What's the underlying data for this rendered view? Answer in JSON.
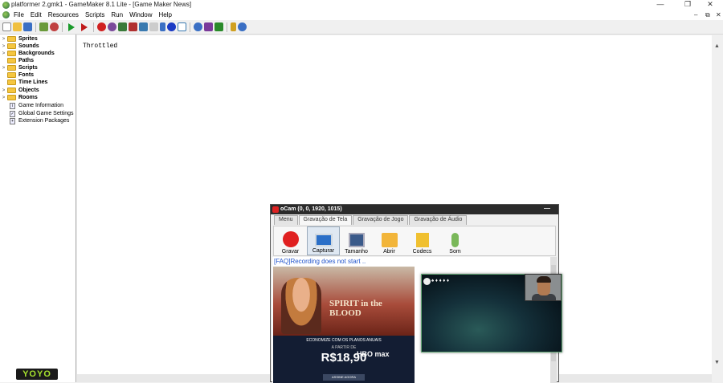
{
  "window": {
    "title": "platformer 2.gmk1 - GameMaker 8.1 Lite - [Game Maker News]",
    "controls": {
      "minimize": "—",
      "restore": "❐",
      "close": "✕"
    },
    "mdi_controls": {
      "minimize": "–",
      "restore": "⧉",
      "close": "✕"
    }
  },
  "menu": [
    "File",
    "Edit",
    "Resources",
    "Scripts",
    "Run",
    "Window",
    "Help"
  ],
  "toolbar_icons": [
    {
      "name": "new-icon",
      "color": "#ffffff"
    },
    {
      "name": "open-icon",
      "color": "#f0c040"
    },
    {
      "name": "save-icon",
      "color": "#3a6fc4"
    },
    {
      "name": "publish-icon",
      "color": "#6a9a3a"
    },
    {
      "name": "exe-icon",
      "color": "#c04040"
    },
    {
      "name": "run-icon",
      "color": "#1a9a2a"
    },
    {
      "name": "debug-icon",
      "color": "#c01a1a"
    },
    {
      "name": "sprite-icon",
      "color": "#d02020"
    },
    {
      "name": "sound-icon",
      "color": "#7a4a9a"
    },
    {
      "name": "background-icon",
      "color": "#3a7a3a"
    },
    {
      "name": "path-icon",
      "color": "#b03030"
    },
    {
      "name": "script-icon",
      "color": "#3a7ab0"
    },
    {
      "name": "font-icon",
      "color": "#444444"
    },
    {
      "name": "timeline-icon",
      "color": "#3a6fc4"
    },
    {
      "name": "object-icon",
      "color": "#1a3ac4"
    },
    {
      "name": "room-icon",
      "color": "#3a7ab0"
    },
    {
      "name": "game-info-icon",
      "color": "#3a6fc4"
    },
    {
      "name": "game-settings-icon",
      "color": "#7a3a9a"
    },
    {
      "name": "extension-icon",
      "color": "#2a8a2a"
    },
    {
      "name": "manual-icon",
      "color": "#d0a020"
    },
    {
      "name": "help-icon",
      "color": "#3a6fc4"
    }
  ],
  "tree": {
    "folders": [
      "Sprites",
      "Sounds",
      "Backgrounds",
      "Paths",
      "Scripts",
      "Fonts",
      "Time Lines",
      "Objects",
      "Rooms"
    ],
    "items": [
      "Game Information",
      "Global Game Settings",
      "Extension Packages"
    ]
  },
  "main": {
    "text": "Throttled"
  },
  "logo": {
    "text": "YOYO"
  },
  "ocam": {
    "title": "oCam (0, 0, 1920, 1015)",
    "min_label": "—",
    "tabs": [
      "Menu",
      "Gravação de Tela",
      "Gravação de Jogo",
      "Gravação de Áudio"
    ],
    "active_tab": "Gravação de Tela",
    "buttons": [
      {
        "label": "Gravar",
        "icon": "record-icon",
        "color": "#e02020"
      },
      {
        "label": "Capturar",
        "icon": "capture-icon",
        "color": "#2a6fc8"
      },
      {
        "label": "Tamanho",
        "icon": "resize-icon",
        "color": "#3a5a8a"
      },
      {
        "label": "Abrir",
        "icon": "folder-icon",
        "color": "#f2b53a"
      },
      {
        "label": "Codecs",
        "icon": "codecs-icon",
        "color": "#f0c030"
      },
      {
        "label": "Som",
        "icon": "microphone-icon",
        "color": "#7ab85a"
      }
    ],
    "faq": "[FAQ]Recording does not start ..",
    "ad": {
      "title": "SPIRIT in the BLOOD",
      "line1": "ECONOMIZE COM OS PLANOS ANUAIS",
      "line2": "A PARTIR DE",
      "price": "R$18,90",
      "brand": "HBO max",
      "cta": "ASSINE AGORA"
    }
  },
  "game_overlay": {
    "hud": "♠ ♦ ♦ ♦ ♦"
  }
}
